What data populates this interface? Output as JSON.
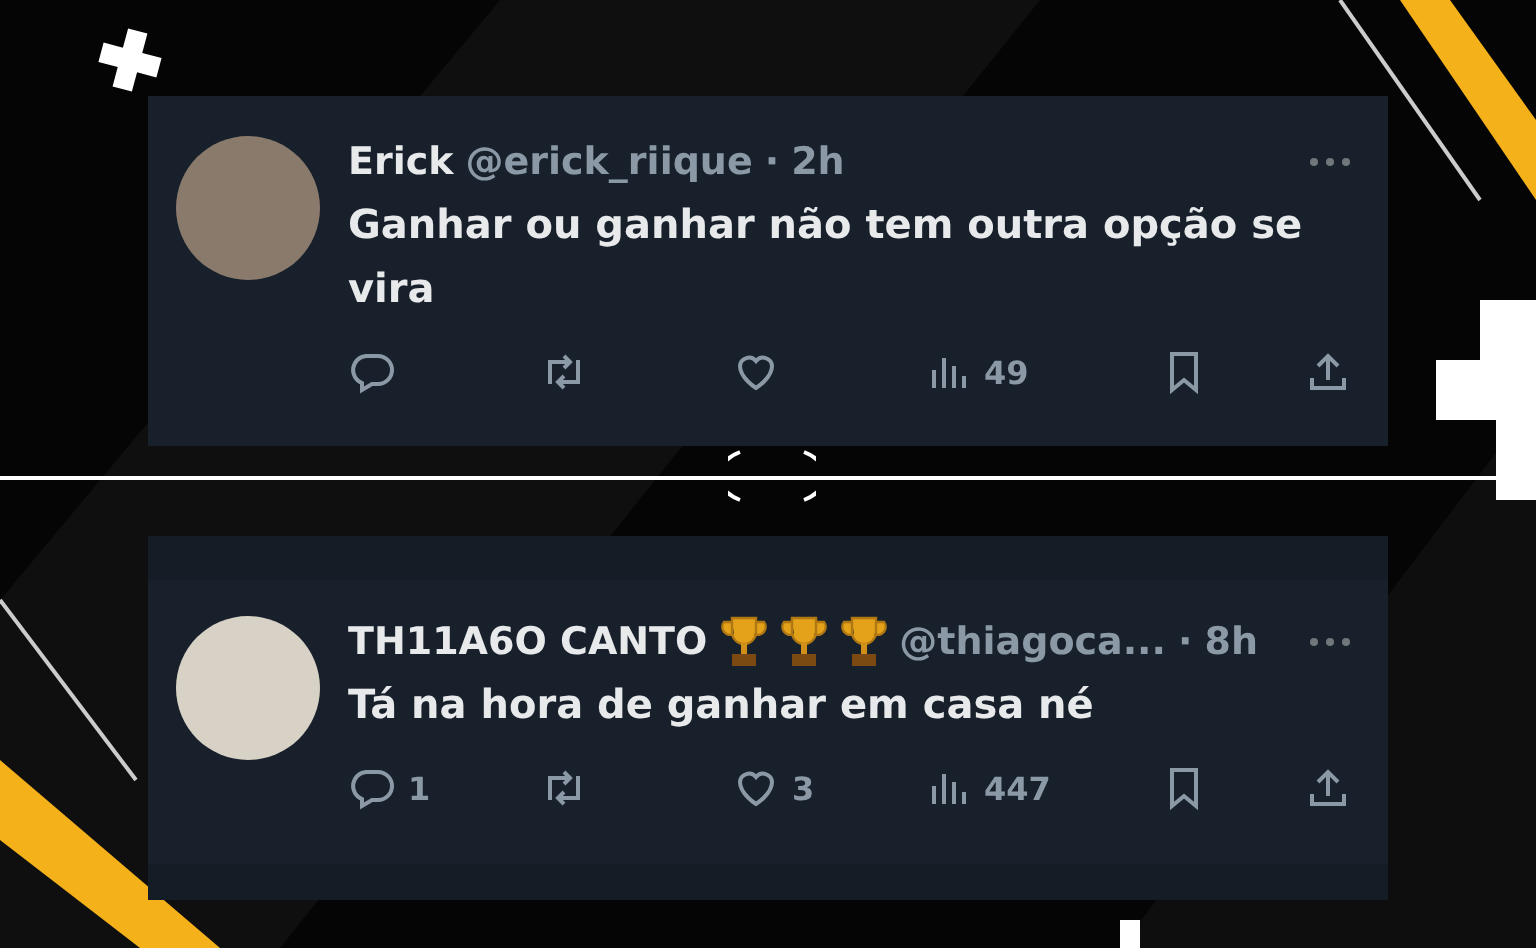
{
  "tweets": [
    {
      "name": "Erick",
      "handle": "@erick_riique",
      "separator": "·",
      "time": "2h",
      "text": "Ganhar ou ganhar não tem outra opção se vira",
      "actions": [
        {
          "kind": "reply"
        },
        {
          "kind": "retweet"
        },
        {
          "kind": "like"
        },
        {
          "kind": "views",
          "count": "49"
        },
        {
          "kind": "bookmark"
        },
        {
          "kind": "share"
        }
      ]
    },
    {
      "name": "TH11A6O CANTO",
      "badges": [
        {
          "kind": "trophy"
        },
        {
          "kind": "trophy"
        },
        {
          "kind": "trophy"
        }
      ],
      "handle": "@thiagoca...",
      "separator": "·",
      "time": "8h",
      "text": "Tá na hora de ganhar em casa né",
      "actions": [
        {
          "kind": "reply",
          "count": "1"
        },
        {
          "kind": "retweet"
        },
        {
          "kind": "like",
          "count": "3"
        },
        {
          "kind": "views",
          "count": "447"
        },
        {
          "kind": "bookmark"
        },
        {
          "kind": "share"
        }
      ]
    }
  ]
}
